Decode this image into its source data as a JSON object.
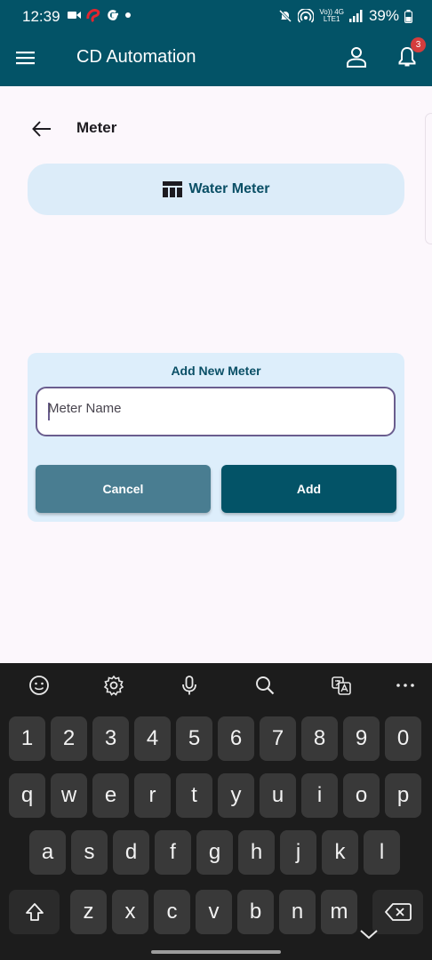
{
  "status_bar": {
    "time": "12:39",
    "network_top": "Vo)) 4G",
    "network_bottom": "LTE1",
    "battery": "39%"
  },
  "app_bar": {
    "title": "CD Automation",
    "notification_count": "3"
  },
  "page": {
    "title": "Meter",
    "meter_tab_label": "Water Meter"
  },
  "dialog": {
    "heading": "Add New Meter",
    "input_placeholder": "Meter Name",
    "input_value": "",
    "cancel_label": "Cancel",
    "add_label": "Add"
  },
  "keyboard": {
    "toolbar": [
      "emoji-icon",
      "settings-icon",
      "microphone-icon",
      "search-icon",
      "translate-icon",
      "more-icon"
    ],
    "row_numbers": [
      "1",
      "2",
      "3",
      "4",
      "5",
      "6",
      "7",
      "8",
      "9",
      "0"
    ],
    "row_top": [
      "q",
      "w",
      "e",
      "r",
      "t",
      "y",
      "u",
      "i",
      "o",
      "p"
    ],
    "row_middle": [
      "a",
      "s",
      "d",
      "f",
      "g",
      "h",
      "j",
      "k",
      "l"
    ],
    "row_bottom": [
      "z",
      "x",
      "c",
      "v",
      "b",
      "n",
      "m"
    ]
  },
  "colors": {
    "primary": "#035367",
    "secondary": "#497d91",
    "tab_background": "#dcecf9",
    "badge": "#d43d3d"
  }
}
